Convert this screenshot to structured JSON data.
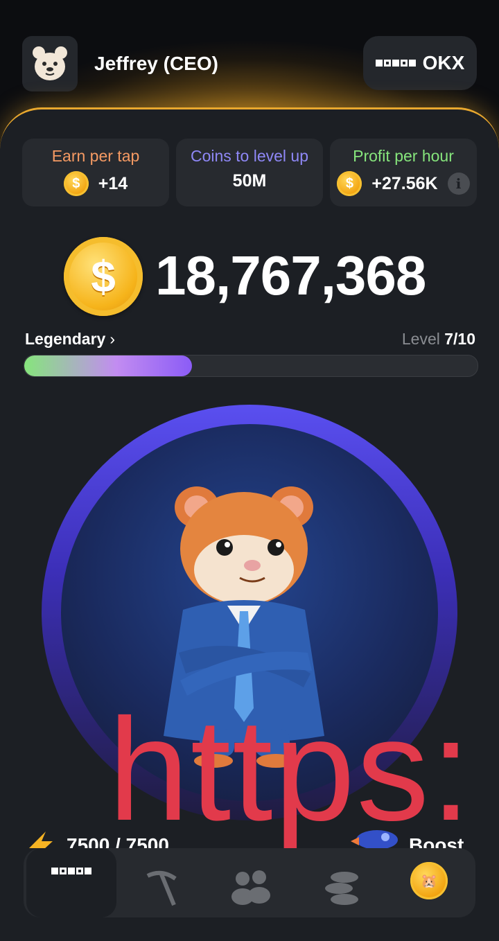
{
  "header": {
    "username": "Jeffrey (CEO)",
    "exchange_label": "OKX",
    "avatar_icon": "hamster-avatar-icon"
  },
  "stats": [
    {
      "label": "Earn per tap",
      "value": "+14",
      "label_color": "#f59a63",
      "icon": "coin-icon"
    },
    {
      "label": "Coins to level up",
      "value": "50M",
      "label_color": "#8f88f7"
    },
    {
      "label": "Profit per hour",
      "value": "+27.56K",
      "label_color": "#86e57c",
      "icon": "coin-icon"
    }
  ],
  "balance": {
    "value": "18,767,368",
    "coin_symbol": "$"
  },
  "level": {
    "rank": "Legendary",
    "rank_chevron": "›",
    "level_prefix": "Level",
    "level_value": "7/10",
    "progress": 0.37
  },
  "watermark": "https:",
  "energy": {
    "value": "7500 / 7500"
  },
  "boost": {
    "label": "Boost"
  },
  "nav": [
    {
      "name": "okx-exchange",
      "active": true
    },
    {
      "name": "mine-icon"
    },
    {
      "name": "friends-icon"
    },
    {
      "name": "earn-icon"
    },
    {
      "name": "airdrop-icon"
    }
  ],
  "colors": {
    "accent_gold": "#e9a82e",
    "panel": "#1c1f24",
    "card": "#272a2f",
    "ring": "#5a4ff0"
  }
}
